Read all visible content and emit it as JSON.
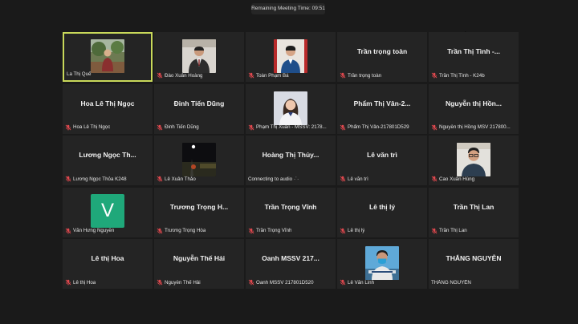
{
  "meeting": {
    "timer_label": "Remaining Meeting Time: 09:51"
  },
  "colors": {
    "active_speaker_border": "#c8d85a",
    "muted_mic": "#e0484e",
    "avatar_bg": "#1fa87a"
  },
  "participants": [
    {
      "name": "La Thị Quế",
      "display": "",
      "muted": false,
      "video": "person-outdoor-video"
    },
    {
      "name": "Đào Xuân Hoàng",
      "display": "",
      "muted": true,
      "video": "person-suit-video"
    },
    {
      "name": "Toàn Phạm Bá",
      "display": "",
      "muted": true,
      "video": "person-portrait-video"
    },
    {
      "name": "Trần trọng toàn",
      "display": "Trần trọng toàn",
      "muted": true
    },
    {
      "name": "Trần Thị Tình - K24b",
      "display": "Trần Thị Tình -...",
      "muted": true
    },
    {
      "name": "Hoa Lê Thị Ngọc",
      "display": "Hoa Lê Thị Ngọc",
      "muted": true
    },
    {
      "name": "Đinh Tiến Dũng",
      "display": "Đinh Tiến Dũng",
      "muted": true
    },
    {
      "name": "Phạm Thị Xuân - MSSV: 2178...",
      "display": "",
      "muted": true,
      "video": "woman-portrait-video"
    },
    {
      "name": "Phẩm Thị Vân-217801D529",
      "display": "Phẩm Thị Vân-2...",
      "muted": true
    },
    {
      "name": "Nguyễn thị Hồng MSV 217800...",
      "display": "Nguyễn thị Hồn...",
      "muted": true
    },
    {
      "name": "Lương Ngọc Thỏa K248",
      "display": "Lương Ngọc Th...",
      "muted": true
    },
    {
      "name": "Lê Xuân Thảo",
      "display": "",
      "muted": true,
      "video": "night-scene-video"
    },
    {
      "name": "Connecting to audio",
      "display": "Hoàng Thị Thủy...",
      "muted": false,
      "connecting": true
    },
    {
      "name": "Lê văn trì",
      "display": "Lê văn trì",
      "muted": true
    },
    {
      "name": "Cao Xuân Hùng",
      "display": "",
      "muted": true,
      "video": "man-glasses-video"
    },
    {
      "name": "Văn Hưng Nguyễn",
      "display": "",
      "muted": true,
      "avatar": "V"
    },
    {
      "name": "Trương Trọng Hòa",
      "display": "Trương Trọng H...",
      "muted": true
    },
    {
      "name": "Trần Trọng Vĩnh",
      "display": "Trần Trọng Vĩnh",
      "muted": true
    },
    {
      "name": "Lê thị lý",
      "display": "Lê thị lý",
      "muted": true
    },
    {
      "name": "Trần Thị Lan",
      "display": "Trần Thị Lan",
      "muted": true
    },
    {
      "name": "Lê thị Hoa",
      "display": "Lê thị Hoa",
      "muted": true
    },
    {
      "name": "Nguyễn Thế Hải",
      "display": "Nguyễn Thế Hải",
      "muted": true
    },
    {
      "name": "Oanh MSSV 217801D520",
      "display": "Oanh MSSV 217...",
      "muted": true
    },
    {
      "name": "Lê Văn Linh",
      "display": "",
      "muted": true,
      "video": "man-mask-video"
    },
    {
      "name": "THẮNG NGUYỄN",
      "display": "THẮNG NGUYỄN",
      "muted": false
    }
  ]
}
